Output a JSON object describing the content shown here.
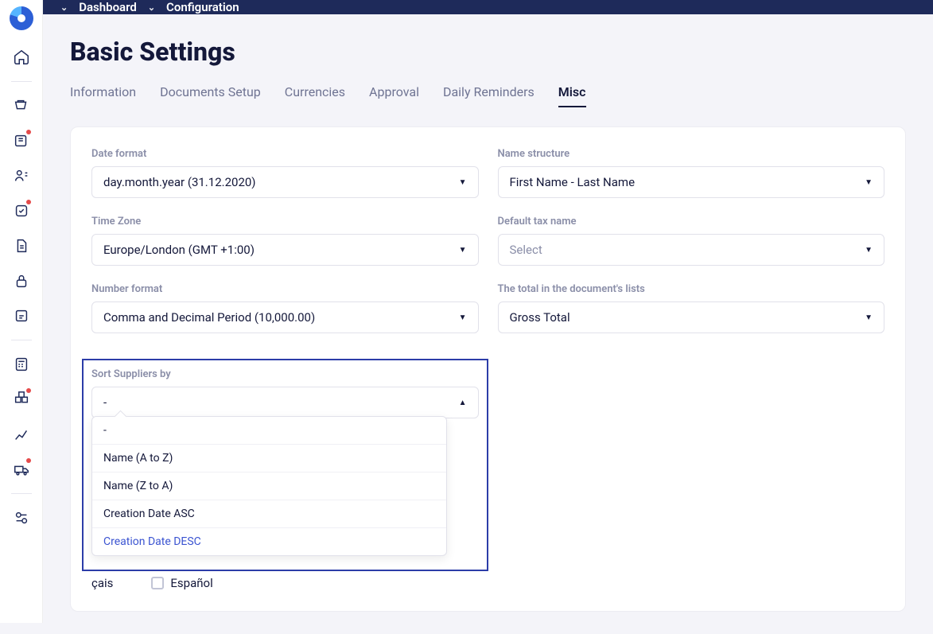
{
  "breadcrumb": {
    "item1": "Dashboard",
    "item2": "Configuration"
  },
  "page_title": "Basic Settings",
  "tabs": {
    "information": "Information",
    "documents": "Documents Setup",
    "currencies": "Currencies",
    "approval": "Approval",
    "reminders": "Daily Reminders",
    "misc": "Misc"
  },
  "fields": {
    "date_format": {
      "label": "Date format",
      "value": "day.month.year (31.12.2020)"
    },
    "name_structure": {
      "label": "Name structure",
      "value": "First Name - Last Name"
    },
    "time_zone": {
      "label": "Time Zone",
      "value": "Europe/London (GMT +1:00)"
    },
    "default_tax": {
      "label": "Default tax name",
      "value": "Select"
    },
    "number_format": {
      "label": "Number format",
      "value": "Comma and Decimal Period (10,000.00)"
    },
    "total_lists": {
      "label": "The total in the document's lists",
      "value": "Gross Total"
    },
    "sort_suppliers": {
      "label": "Sort Suppliers by",
      "value": "-"
    }
  },
  "sort_options": {
    "opt0": "-",
    "opt1": "Name (A to Z)",
    "opt2": "Name (Z to A)",
    "opt3": "Creation Date ASC",
    "opt4": "Creation Date DESC"
  },
  "languages": {
    "fr_partial": "çais",
    "es": "Español"
  }
}
